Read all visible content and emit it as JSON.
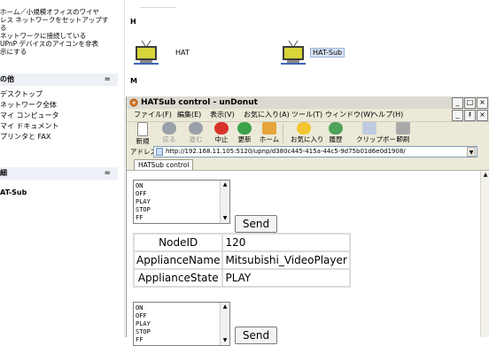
{
  "left_pane": {
    "network_tasks": [
      "ホーム／小規模オフィスのワイヤ",
      "レス ネットワークをセットアップす",
      "る",
      "ネットワークに接続している",
      "UPnP デバイスのアイコンを非表",
      "示にする"
    ],
    "other_places": {
      "title": "の他",
      "items": [
        "デスクトップ",
        "ネットワーク全体",
        "マイ コンピュータ",
        "マイ ドキュメント",
        "プリンタと FAX"
      ]
    },
    "details": {
      "title": "細",
      "item": "AT-Sub"
    },
    "chevron": "≈"
  },
  "explorer": {
    "group_h": "H",
    "group_m": "M",
    "devices": [
      {
        "label": "HAT",
        "selected": false
      },
      {
        "label": "HAT-Sub",
        "selected": true
      }
    ]
  },
  "window": {
    "title": "HATSub control - unDonut",
    "window_buttons": [
      "_",
      "□",
      "×"
    ],
    "mdi_buttons": [
      "_",
      "ｷ",
      "×"
    ],
    "menu": [
      "ファイル(F)",
      "編集(E)",
      "表示(V)",
      "お気に入り(A)",
      "ツール(T)",
      "ウィンドウ(W)",
      "ヘルプ(H)"
    ],
    "toolbar": [
      {
        "label": "新規",
        "icon": "new-page-icon",
        "disabled": false
      },
      {
        "label": "戻る",
        "icon": "back-arrow-icon",
        "disabled": true
      },
      {
        "label": "進む",
        "icon": "forward-arrow-icon",
        "disabled": true
      },
      {
        "label": "中止",
        "icon": "stop-icon",
        "disabled": false
      },
      {
        "label": "更新",
        "icon": "refresh-icon",
        "disabled": false
      },
      {
        "label": "ホーム",
        "icon": "home-icon",
        "disabled": false
      },
      {
        "label": "お気に入り",
        "icon": "favorites-star-icon",
        "disabled": false
      },
      {
        "label": "履歴",
        "icon": "history-icon",
        "disabled": false
      },
      {
        "label": "クリップボード",
        "icon": "clipboard-icon",
        "disabled": false
      },
      {
        "label": "印刷",
        "icon": "print-icon",
        "disabled": false
      }
    ],
    "address": {
      "label": "アドレス",
      "url": "http://192.168.11.105:5120/upnp/d380c445-415a-44c5-9d75b01d6e0d1908/"
    },
    "tab": "HATSub control"
  },
  "page": {
    "command_options": [
      "ON",
      "OFF",
      "PLAY",
      "STOP",
      "FF"
    ],
    "send_label": "Send",
    "info": [
      {
        "key": "NodeID",
        "value": "120"
      },
      {
        "key": "ApplianceName",
        "value": "Mitsubishi_VideoPlayer"
      },
      {
        "key": "ApplianceState",
        "value": "PLAY"
      }
    ]
  },
  "colors": {
    "selection": "#d8e4f8",
    "section_header": "#eef0f7",
    "window_chrome": "#ece9d8"
  }
}
